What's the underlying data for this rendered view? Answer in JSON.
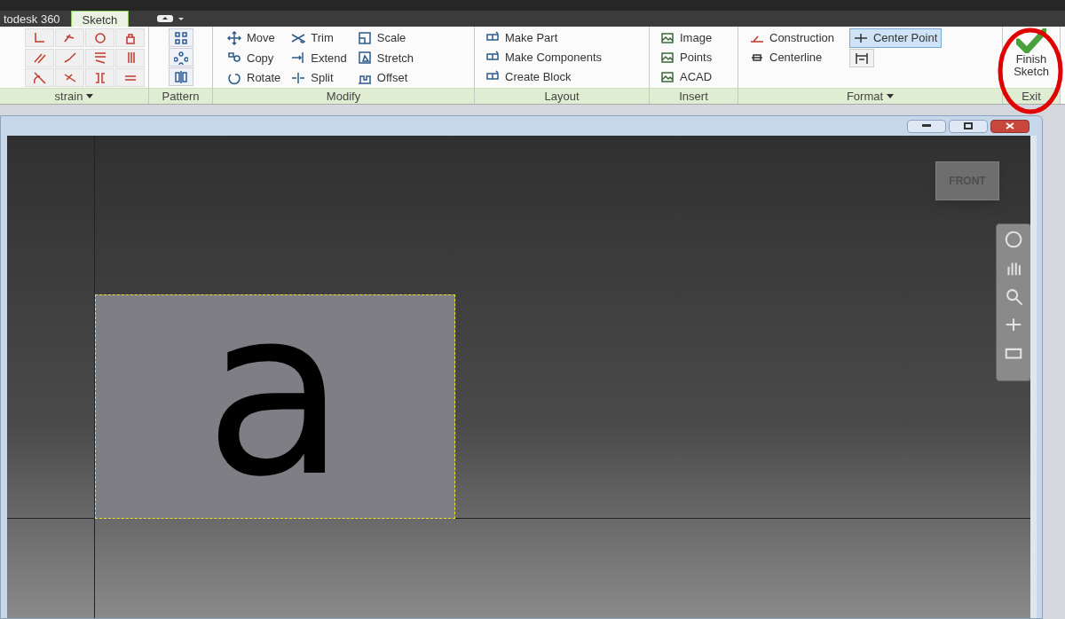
{
  "tabs": [
    {
      "label": "todesk 360",
      "selected": false
    },
    {
      "label": "Sketch",
      "selected": true
    }
  ],
  "ribbon": {
    "constrain": {
      "title": "strain"
    },
    "pattern": {
      "title": "Pattern"
    },
    "modify": {
      "title": "Modify",
      "tools": [
        {
          "kind": "move",
          "label": "Move"
        },
        {
          "kind": "copy",
          "label": "Copy"
        },
        {
          "kind": "rotate",
          "label": "Rotate"
        },
        {
          "kind": "trim",
          "label": "Trim"
        },
        {
          "kind": "extend",
          "label": "Extend"
        },
        {
          "kind": "split",
          "label": "Split"
        },
        {
          "kind": "scale",
          "label": "Scale"
        },
        {
          "kind": "stretch",
          "label": "Stretch"
        },
        {
          "kind": "offset",
          "label": "Offset"
        }
      ]
    },
    "layout": {
      "title": "Layout",
      "tools": [
        "Make Part",
        "Make Components",
        "Create Block"
      ]
    },
    "insert": {
      "title": "Insert",
      "tools": [
        "Image",
        "Points",
        "ACAD"
      ]
    },
    "format": {
      "title": "Format",
      "tools": [
        {
          "label": "Construction",
          "selected": false
        },
        {
          "label": "Centerline",
          "selected": false
        },
        {
          "label": "Center Point",
          "selected": true
        }
      ]
    },
    "exit": {
      "title": "Exit",
      "button": "Finish Sketch"
    }
  },
  "viewport": {
    "view_cube": "FRONT",
    "sketch_text": "a"
  }
}
